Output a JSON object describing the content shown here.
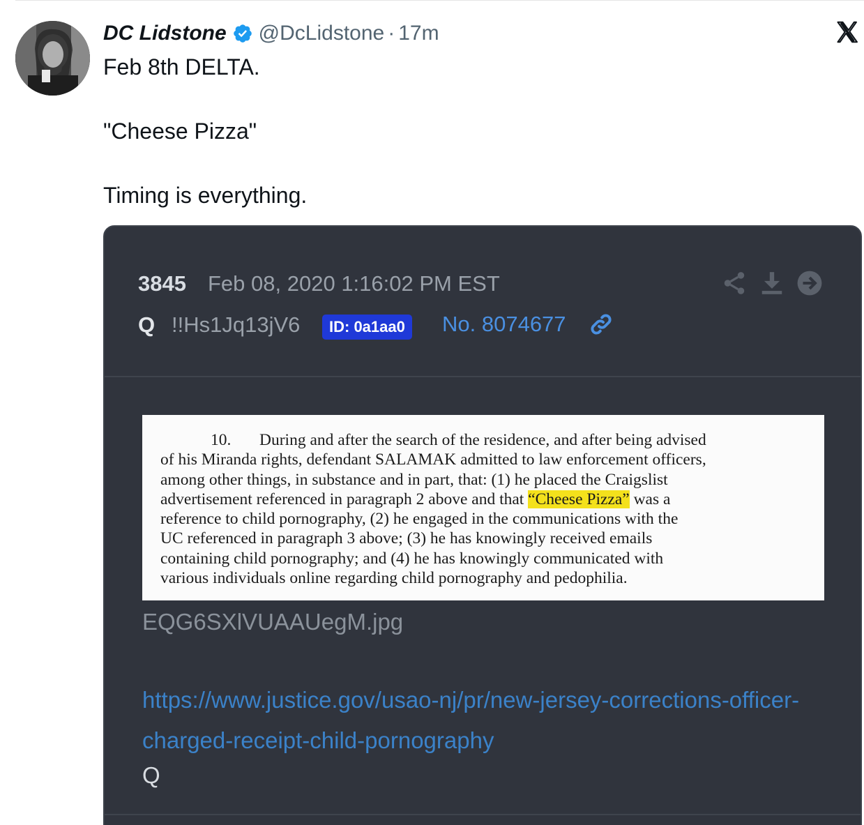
{
  "tweet": {
    "author_name": "DC Lidstone",
    "handle": "@DcLidstone",
    "separator": "·",
    "time": "17m",
    "lines": [
      "Feb 8th DELTA.",
      "\"Cheese Pizza\"",
      "Timing is everything."
    ]
  },
  "icons": {
    "verified": "verified-badge-icon",
    "x_logo": "x-logo-icon",
    "share": "share-icon",
    "download": "download-icon",
    "go": "arrow-right-circle-icon",
    "link": "link-icon"
  },
  "colors": {
    "verified": "#1d9bf0",
    "card_bg": "#30343d",
    "id_badge": "#1f39d8",
    "post_link": "#4a90e2",
    "url": "#3b82c9",
    "highlight": "#f4e11c"
  },
  "card": {
    "post_number": "3845",
    "date": "Feb 08, 2020 1:16:02 PM EST",
    "author": "Q",
    "tripcode": "!!Hs1Jq13jV6",
    "id_badge": "ID: 0a1aa0",
    "post_no": "No. 8074677",
    "filename": "EQG6SXlVUAAUegM.jpg",
    "url": "https://www.justice.gov/usao-nj/pr/new-jersey-corrections-officer-charged-receipt-child-pornography",
    "signature": "Q"
  },
  "document": {
    "paragraph_number": "10.",
    "line1": "During and after the search of the residence, and after being advised",
    "line2": "of his Miranda rights, defendant SALAMAK admitted to law enforcement officers,",
    "line3": "among other things, in substance and in part, that: (1) he placed the Craigslist",
    "line4_before": "advertisement referenced in paragraph 2 above and that ",
    "line4_highlight": "“Cheese Pizza”",
    "line4_after": " was a",
    "line5": "reference to child pornography, (2) he engaged in the communications with the",
    "line6": "UC referenced in paragraph 3 above; (3) he has knowingly received emails",
    "line7": "containing child pornography; and (4) he has knowingly communicated with",
    "line8": "various individuals online regarding child pornography and pedophilia."
  }
}
